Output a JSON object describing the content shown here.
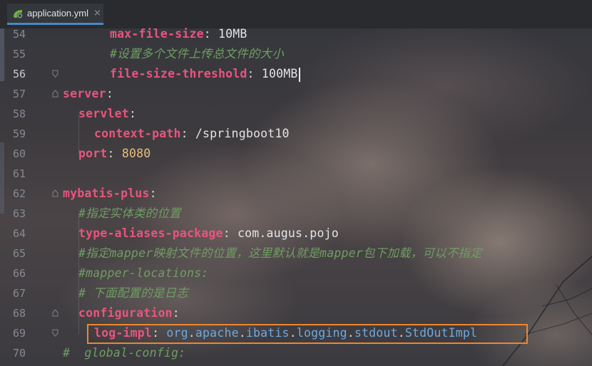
{
  "tab": {
    "filename": "application.yml",
    "icon": "spring-leaf-icon",
    "close": "×",
    "accent": "#4a88c7"
  },
  "colors": {
    "key": "#e8557e",
    "comment": "#6f9e62",
    "number": "#e6c07b",
    "package": "#6ea9de",
    "highlight_box": "#f0862d"
  },
  "lines": [
    {
      "num": "54",
      "key": "max-file-size",
      "sep": ": ",
      "value": "10MB"
    },
    {
      "num": "55",
      "comment": "#设置多个文件上传总文件的大小"
    },
    {
      "num": "56",
      "key": "file-size-threshold",
      "sep": ": ",
      "value": "100MB"
    },
    {
      "num": "57",
      "key": "server",
      "sep": ":"
    },
    {
      "num": "58",
      "key": "servlet",
      "sep": ":"
    },
    {
      "num": "59",
      "key": "context-path",
      "sep": ": ",
      "value": "/springboot10"
    },
    {
      "num": "60",
      "key": "port",
      "sep": ": ",
      "value": "8080"
    },
    {
      "num": "61"
    },
    {
      "num": "62",
      "key": "mybatis-plus",
      "sep": ":"
    },
    {
      "num": "63",
      "comment": "#指定实体类的位置"
    },
    {
      "num": "64",
      "key": "type-aliases-package",
      "sep": ": ",
      "value": "com.augus.pojo"
    },
    {
      "num": "65",
      "comment": "#指定mapper映射文件的位置，这里默认就是mapper包下加载，可以不指定"
    },
    {
      "num": "66",
      "comment": "#mapper-locations:"
    },
    {
      "num": "67",
      "comment": "# 下面配置的是日志"
    },
    {
      "num": "68",
      "key": "configuration",
      "sep": ":"
    },
    {
      "num": "69",
      "key": "log-impl",
      "sep": ": ",
      "pkg": [
        "org",
        "apache",
        "ibatis",
        "logging",
        "stdout",
        "StdOutImpl"
      ],
      "dot": "."
    },
    {
      "num": "70",
      "comment": "#  global-config:"
    }
  ]
}
